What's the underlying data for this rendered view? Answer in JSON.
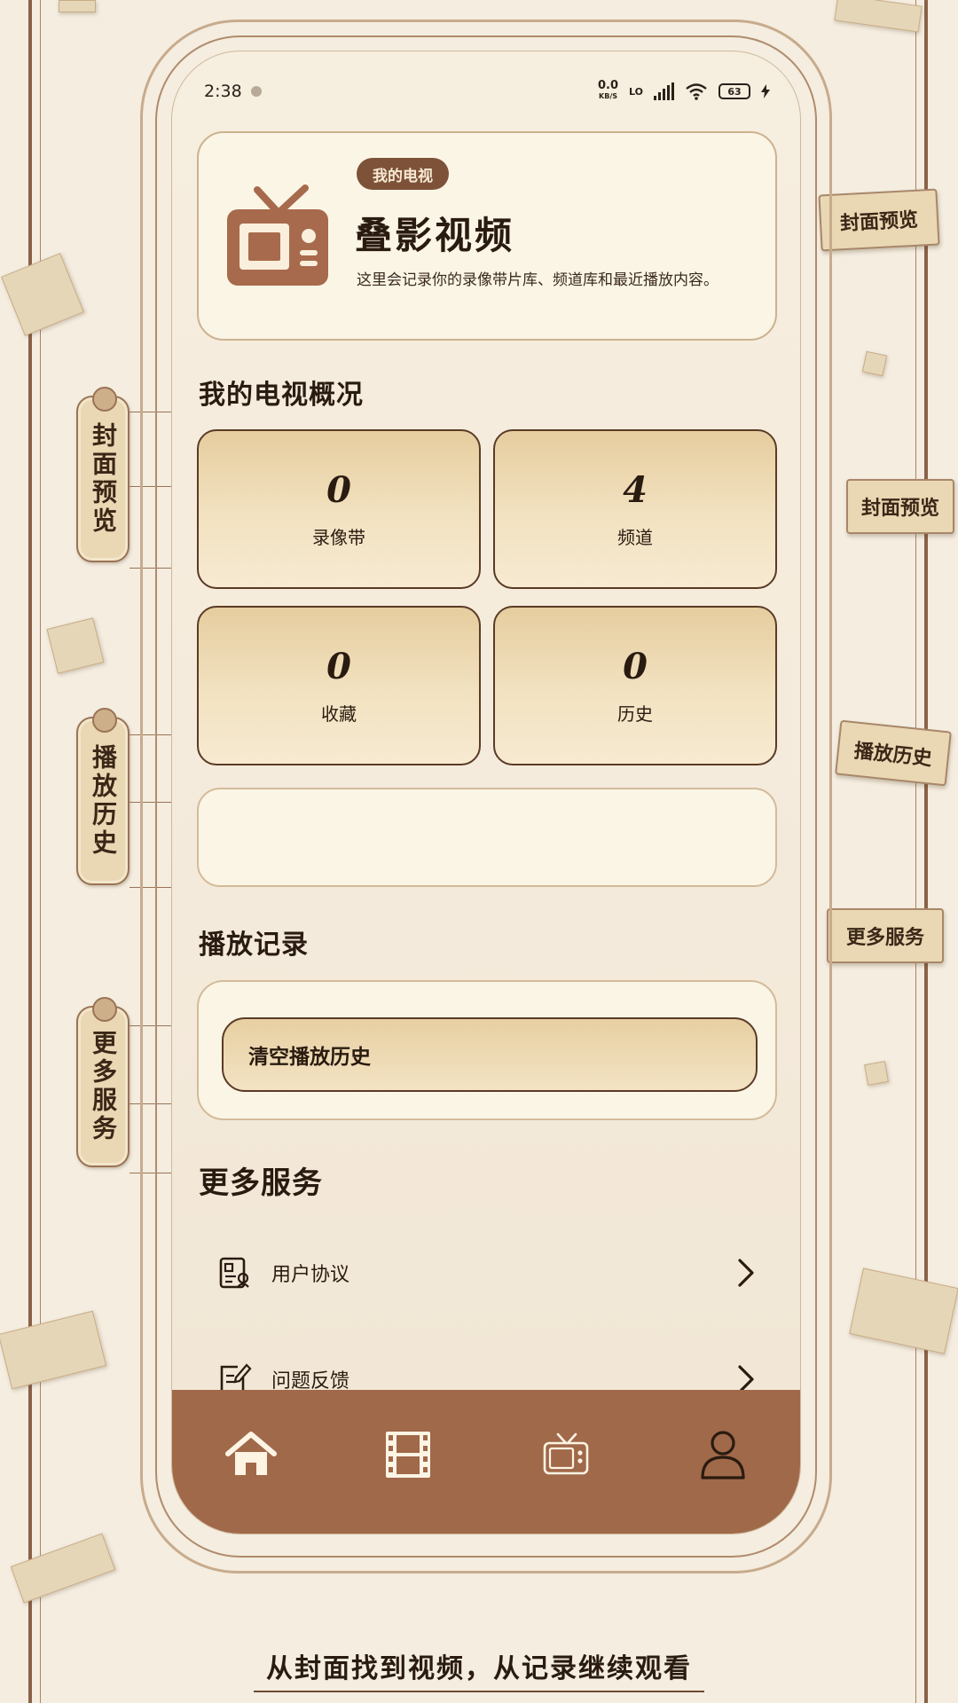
{
  "status_bar": {
    "time": "2:38",
    "network_top": "0.0",
    "network_bottom": "KB/S",
    "lte": "LO",
    "battery": "63"
  },
  "header": {
    "badge": "我的电视",
    "title": "叠影视频",
    "description": "这里会记录你的录像带片库、频道库和最近播放内容。"
  },
  "overview": {
    "title": "我的电视概况",
    "stats": [
      {
        "value": "0",
        "label": "录像带"
      },
      {
        "value": "4",
        "label": "频道"
      },
      {
        "value": "0",
        "label": "收藏"
      },
      {
        "value": "0",
        "label": "历史"
      }
    ]
  },
  "records": {
    "title": "播放记录",
    "clear_label": "清空播放历史"
  },
  "services": {
    "title": "更多服务",
    "items": [
      {
        "label": "用户协议",
        "icon": "agreement-icon"
      },
      {
        "label": "问题反馈",
        "icon": "feedback-icon"
      }
    ]
  },
  "tabbar": {
    "items": [
      {
        "icon": "home-icon"
      },
      {
        "icon": "film-icon"
      },
      {
        "icon": "tv-icon"
      },
      {
        "icon": "user-icon"
      }
    ]
  },
  "annotations": {
    "left": [
      "封面预览",
      "播放历史",
      "更多服务"
    ],
    "right": [
      "封面预览",
      "封面预览",
      "播放历史",
      "更多服务"
    ]
  },
  "caption": "从封面找到视频，从记录继续观看",
  "colors": {
    "background": "#f4ede0",
    "accent_brown": "#a0694a",
    "badge_brown": "#7d5238",
    "card_cream": "#fbf5e6",
    "stat_gold": "#e6cd9f"
  }
}
